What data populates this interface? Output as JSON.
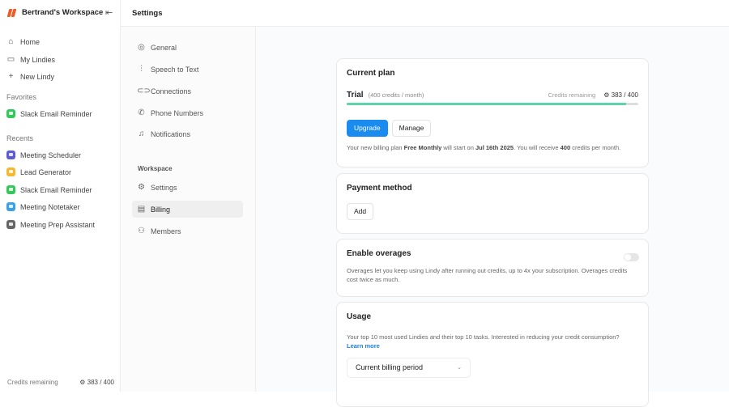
{
  "sidebar": {
    "workspace": "Bertrand's Workspace",
    "nav": [
      {
        "label": "Home"
      },
      {
        "label": "My Lindies"
      },
      {
        "label": "New Lindy"
      }
    ],
    "favorites_title": "Favorites",
    "favorites": [
      {
        "label": "Slack Email Reminder",
        "color": "#34c759"
      }
    ],
    "recents_title": "Recents",
    "recents": [
      {
        "label": "Meeting Scheduler",
        "color": "#5b5bd6"
      },
      {
        "label": "Lead Generator",
        "color": "#f5b82e"
      },
      {
        "label": "Slack Email Reminder",
        "color": "#34c759"
      },
      {
        "label": "Meeting Notetaker",
        "color": "#3aa0e8"
      },
      {
        "label": "Meeting Prep Assistant",
        "color": "#666666"
      }
    ],
    "credits_label": "Credits remaining",
    "credits_value": "383 / 400"
  },
  "header": {
    "title": "Settings"
  },
  "settings_nav": {
    "items": [
      {
        "label": "General"
      },
      {
        "label": "Speech to Text"
      },
      {
        "label": "Connections"
      },
      {
        "label": "Phone Numbers"
      },
      {
        "label": "Notifications"
      }
    ],
    "workspace_title": "Workspace",
    "workspace_items": [
      {
        "label": "Settings"
      },
      {
        "label": "Billing"
      },
      {
        "label": "Members"
      }
    ]
  },
  "plan": {
    "title": "Current plan",
    "name": "Trial",
    "detail": "(400 credits / month)",
    "credits_label": "Credits remaining",
    "credits_value": "383 / 400",
    "progress": 0.9575,
    "upgrade": "Upgrade",
    "manage": "Manage",
    "note_1": "Your new billing plan ",
    "note_plan": "Free Monthly",
    "note_2": " will start on ",
    "note_date": "Jul 16th 2025",
    "note_3": ". You will receive ",
    "note_credits": "400",
    "note_4": " credits per month."
  },
  "payment": {
    "title": "Payment method",
    "add": "Add"
  },
  "overages": {
    "title": "Enable overages",
    "enabled": false,
    "desc": "Overages let you keep using Lindy after running out credits, up to 4x your subscription. Overages credits cost twice as much."
  },
  "usage": {
    "title": "Usage",
    "desc": "Your top 10 most used Lindies and their top 10 tasks. Interested in reducing your credit consumption?",
    "learn_more": "Learn more",
    "period": "Current billing period"
  }
}
